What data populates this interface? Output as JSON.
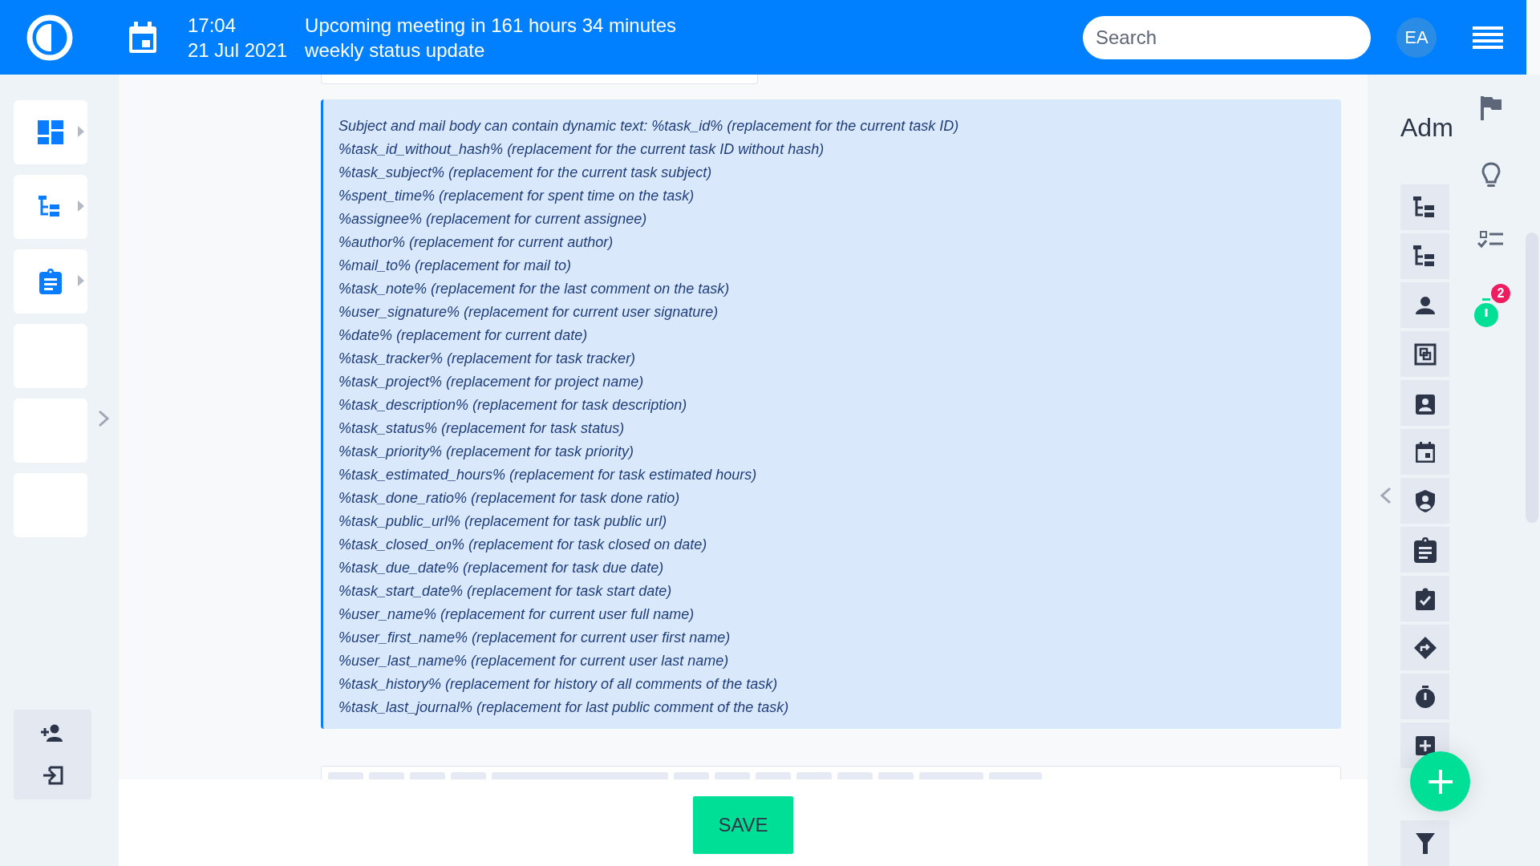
{
  "header": {
    "time": "17:04",
    "meeting": "Upcoming meeting in 161 hours 34 minutes",
    "date": "21 Jul 2021",
    "meeting_title": "weekly status update",
    "search": {
      "placeholder": "Search"
    },
    "avatar": "EA"
  },
  "sidebar": {
    "items": [
      {
        "kind": "dashboard",
        "has_submenu": true
      },
      {
        "kind": "tree",
        "has_submenu": true
      },
      {
        "kind": "clipboard",
        "has_submenu": true
      },
      {
        "kind": "empty",
        "has_submenu": false
      },
      {
        "kind": "empty",
        "has_submenu": false
      },
      {
        "kind": "empty",
        "has_submenu": false
      }
    ]
  },
  "help_lines": [
    "Subject and mail body can contain dynamic text: %task_id% (replacement for the current task ID)",
    "%task_id_without_hash% (replacement for the current task ID without hash)",
    "%task_subject% (replacement for the current task subject)",
    "%spent_time% (replacement for spent time on the task)",
    "%assignee% (replacement for current assignee)",
    "%author% (replacement for current author)",
    "%mail_to% (replacement for mail to)",
    "%task_note% (replacement for the last comment on the task)",
    "%user_signature% (replacement for current user signature)",
    "%date% (replacement for current date)",
    "%task_tracker% (replacement for task tracker)",
    "%task_project% (replacement for project name)",
    "%task_description% (replacement for task description)",
    "%task_status% (replacement for task status)",
    "%task_priority% (replacement for task priority)",
    "%task_estimated_hours% (replacement for task estimated hours)",
    "%task_done_ratio% (replacement for task done ratio)",
    "%task_public_url% (replacement for task public url)",
    "%task_closed_on% (replacement for task closed on date)",
    "%task_due_date% (replacement for task due date)",
    "%task_start_date% (replacement for task start date)",
    "%user_name% (replacement for current user full name)",
    "%user_first_name% (replacement for current user first name)",
    "%user_last_name% (replacement for current user last name)",
    "%task_history% (replacement for history of all comments of the task)",
    "%task_last_journal% (replacement for last public comment of the task)"
  ],
  "save_button": "SAVE",
  "right_panel": {
    "heading": "Adm",
    "timer_badge": "2"
  }
}
